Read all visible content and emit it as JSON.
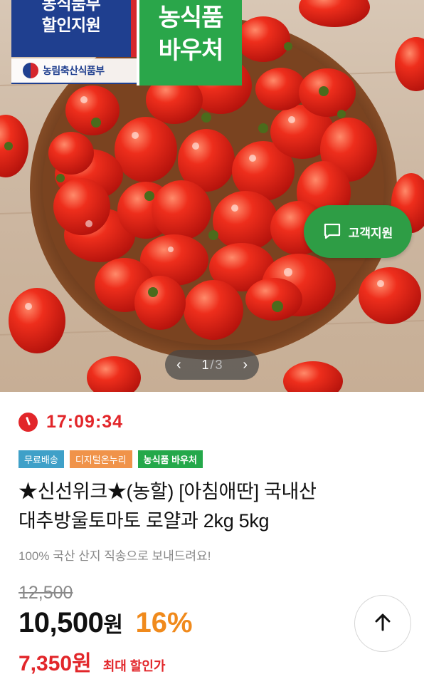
{
  "hero": {
    "badge_left_line1": "농식품부",
    "badge_left_line2": "할인지원",
    "ministry_text": "농림축산식품부",
    "badge_right_line1": "농식품",
    "badge_right_line2": "바우처",
    "support_label": "고객지원",
    "support_icon": "chat-bubble-icon",
    "pager_current": "1",
    "pager_sep": "/",
    "pager_total": "3"
  },
  "product": {
    "countdown": "17:09:34",
    "tags": [
      "무료배송",
      "디지털온누리",
      "농식품 바우처"
    ],
    "title_line1": "★신선위크★(농할) [아침애딴] 국내산",
    "title_line2": "대추방울토마토 로얄과 2kg 5kg",
    "subtitle": "100% 국산 산지 직송으로 보내드려요!",
    "original_price": "12,500",
    "price": "10,500",
    "price_unit": "원",
    "discount": "16%",
    "best_price": "7,350원",
    "best_label": "최대 할인가"
  },
  "colors": {
    "accent_red": "#e2262a",
    "accent_orange": "#f08a1c",
    "brand_green": "#2aa64a",
    "badge_blue": "#1f3f8f"
  }
}
